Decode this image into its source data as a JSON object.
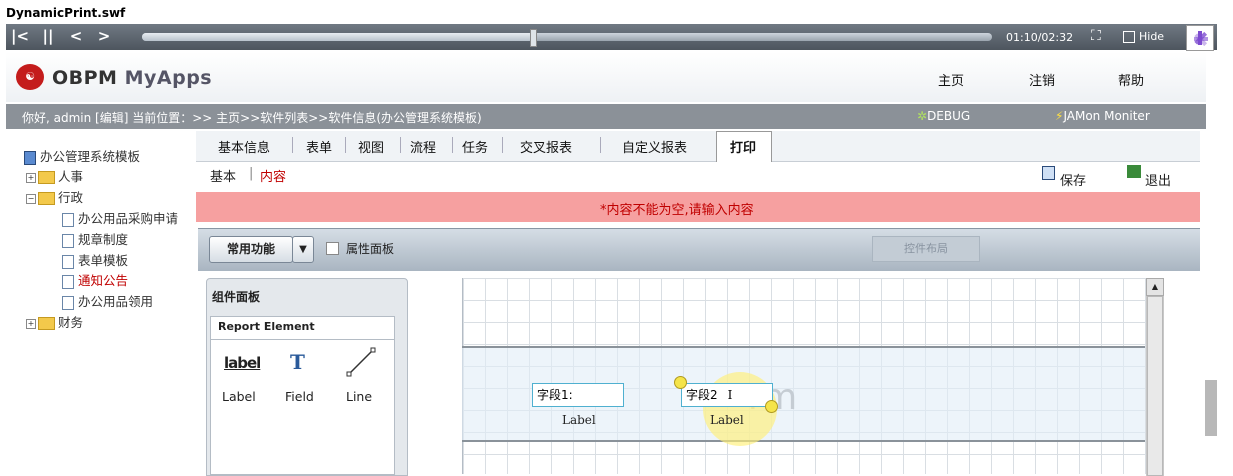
{
  "swf_title": "DynamicPrint.swf",
  "player": {
    "buttons": [
      "|<",
      "||",
      "<",
      ">"
    ],
    "time": "01:10/02:32",
    "progress": 0.46,
    "hide_label": "Hide"
  },
  "header": {
    "brand_main": "OBPM",
    "brand_sub": "MyApps",
    "nav": [
      "主页",
      "注销",
      "帮助"
    ]
  },
  "userbar": {
    "greeting": "你好, admin [编辑]    当前位置：>> 主页>>软件列表>>软件信息(办公管理系统模板)",
    "debug": "DEBUG",
    "jamon": "JAMon Moniter"
  },
  "tree": {
    "root": "办公管理系统模板",
    "nodes": [
      "人事",
      "行政",
      "办公用品采购申请",
      "规章制度",
      "表单模板",
      "通知公告",
      "办公用品领用",
      "财务"
    ]
  },
  "tabs": [
    "基本信息",
    "表单",
    "视图",
    "流程",
    "任务",
    "交叉报表",
    "自定义报表",
    "打印"
  ],
  "subtabs": {
    "basic": "基本",
    "sep": "|",
    "content": "内容"
  },
  "actions": {
    "save": "保存",
    "exit": "退出"
  },
  "error": "*内容不能为空,请输入内容",
  "toolbar": {
    "common": "常用功能",
    "dropdown": "▼",
    "prop_panel": "属性面板",
    "layout": "控件布局"
  },
  "component_panel": {
    "title": "组件面板",
    "report_title": "Report Element",
    "items": [
      {
        "icon": "label",
        "name": "Label"
      },
      {
        "icon": "T",
        "name": "Field"
      },
      {
        "icon": "line",
        "name": "Line"
      }
    ]
  },
  "canvas": {
    "watermark": "rm",
    "field1_value": "字段1:",
    "field1_type": "Label",
    "field2_value": "字段2",
    "field2_type": "Label"
  },
  "colors": {
    "error_bg": "#f6a0a0",
    "error_text": "#c00000",
    "accent_red": "#c41c1c"
  }
}
